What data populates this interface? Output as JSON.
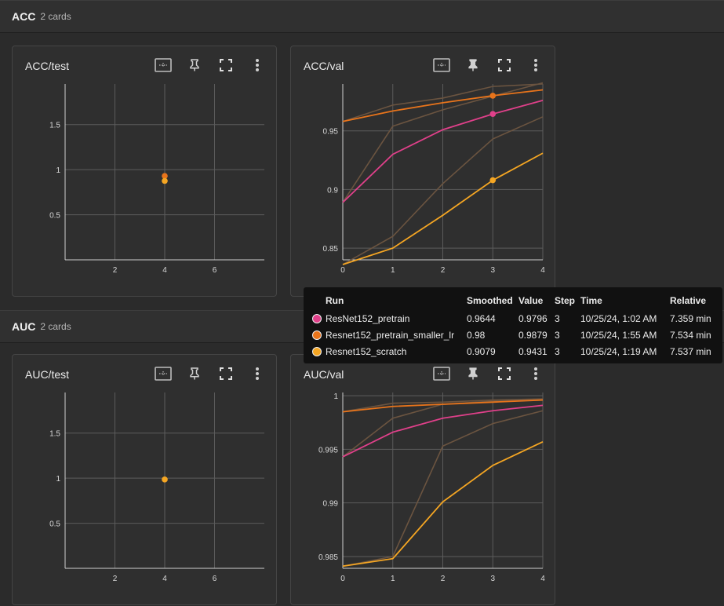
{
  "sections": [
    {
      "title": "ACC",
      "count": "2 cards"
    },
    {
      "title": "AUC",
      "count": "2 cards"
    }
  ],
  "colors": {
    "ResNet152_pretrain": "#e0408a",
    "Resnet152_pretrain_smaller_lr": "#e8741b",
    "Resnet152_scratch": "#f5a623",
    "raw_line": "#6b5440"
  },
  "icons": [
    "fit-domain-icon",
    "pin-icon",
    "fullscreen-icon",
    "more-vert-icon"
  ],
  "cards": [
    {
      "title": "ACC/test",
      "chart_data": {
        "type": "scatter",
        "x_ticks": [
          "2",
          "4",
          "6"
        ],
        "y_ticks": [
          "0.5",
          "1",
          "1.5"
        ],
        "xlim": [
          0,
          8
        ],
        "ylim": [
          0,
          1.95
        ],
        "series": [
          {
            "name": "Resnet152_pretrain_smaller_lr",
            "x": [
              4
            ],
            "y": [
              0.93
            ]
          },
          {
            "name": "Resnet152_scratch",
            "x": [
              4
            ],
            "y": [
              0.875
            ]
          }
        ]
      }
    },
    {
      "title": "ACC/val",
      "chart_data": {
        "type": "line",
        "x_ticks": [
          "0",
          "1",
          "2",
          "3",
          "4"
        ],
        "y_ticks": [
          "0.85",
          "0.9",
          "0.95"
        ],
        "xlim": [
          0,
          4
        ],
        "ylim": [
          0.84,
          0.99
        ],
        "hover_step": 3,
        "series": [
          {
            "name": "ResNet152_pretrain",
            "x": [
              0,
              1,
              2,
              3,
              4
            ],
            "smoothed": [
              0.889,
              0.93,
              0.951,
              0.9644,
              0.976
            ],
            "raw": [
              0.889,
              0.954,
              0.968,
              0.9796,
              0.991
            ]
          },
          {
            "name": "Resnet152_pretrain_smaller_lr",
            "x": [
              0,
              1,
              2,
              3,
              4
            ],
            "smoothed": [
              0.958,
              0.967,
              0.974,
              0.98,
              0.985
            ],
            "raw": [
              0.958,
              0.972,
              0.978,
              0.9879,
              0.99
            ]
          },
          {
            "name": "Resnet152_scratch",
            "x": [
              0,
              1,
              2,
              3,
              4
            ],
            "smoothed": [
              0.836,
              0.85,
              0.878,
              0.9079,
              0.931
            ],
            "raw": [
              0.836,
              0.86,
              0.905,
              0.9431,
              0.962
            ]
          }
        ]
      }
    },
    {
      "title": "AUC/test",
      "chart_data": {
        "type": "scatter",
        "x_ticks": [
          "2",
          "4",
          "6"
        ],
        "y_ticks": [
          "0.5",
          "1",
          "1.5"
        ],
        "xlim": [
          0,
          8
        ],
        "ylim": [
          0,
          1.95
        ],
        "series": [
          {
            "name": "Resnet152_scratch",
            "x": [
              4
            ],
            "y": [
              0.985
            ]
          }
        ]
      }
    },
    {
      "title": "AUC/val",
      "chart_data": {
        "type": "line",
        "x_ticks": [
          "0",
          "1",
          "2",
          "3",
          "4"
        ],
        "y_ticks": [
          "0.985",
          "0.99",
          "0.995",
          "1"
        ],
        "xlim": [
          0,
          4
        ],
        "ylim": [
          0.9839,
          1.0003
        ],
        "series": [
          {
            "name": "ResNet152_pretrain",
            "x": [
              0,
              1,
              2,
              3,
              4
            ],
            "smoothed": [
              0.9943,
              0.9966,
              0.9979,
              0.9986,
              0.9991
            ],
            "raw": [
              0.9943,
              0.9979,
              0.9992,
              0.9995,
              0.9997
            ]
          },
          {
            "name": "Resnet152_pretrain_smaller_lr",
            "x": [
              0,
              1,
              2,
              3,
              4
            ],
            "smoothed": [
              0.9985,
              0.999,
              0.9992,
              0.9994,
              0.9996
            ],
            "raw": [
              0.9985,
              0.9993,
              0.9994,
              0.9996,
              0.9997
            ]
          },
          {
            "name": "Resnet152_scratch",
            "x": [
              0,
              1,
              2,
              3,
              4
            ],
            "smoothed": [
              0.9841,
              0.9848,
              0.9901,
              0.9935,
              0.9957
            ],
            "raw": [
              0.9841,
              0.985,
              0.9953,
              0.9974,
              0.9986
            ]
          }
        ]
      }
    }
  ],
  "tooltip": {
    "headers": {
      "run": "Run",
      "smoothed": "Smoothed",
      "value": "Value",
      "step": "Step",
      "time": "Time",
      "relative": "Relative"
    },
    "rows": [
      {
        "run": "ResNet152_pretrain",
        "smoothed": "0.9644",
        "value": "0.9796",
        "step": "3",
        "time": "10/25/24, 1:02 AM",
        "relative": "7.359 min",
        "color": "#e0408a"
      },
      {
        "run": "Resnet152_pretrain_smaller_lr",
        "smoothed": "0.98",
        "value": "0.9879",
        "step": "3",
        "time": "10/25/24, 1:55 AM",
        "relative": "7.534 min",
        "color": "#e8741b"
      },
      {
        "run": "Resnet152_scratch",
        "smoothed": "0.9079",
        "value": "0.9431",
        "step": "3",
        "time": "10/25/24, 1:19 AM",
        "relative": "7.537 min",
        "color": "#f5a623"
      }
    ]
  }
}
